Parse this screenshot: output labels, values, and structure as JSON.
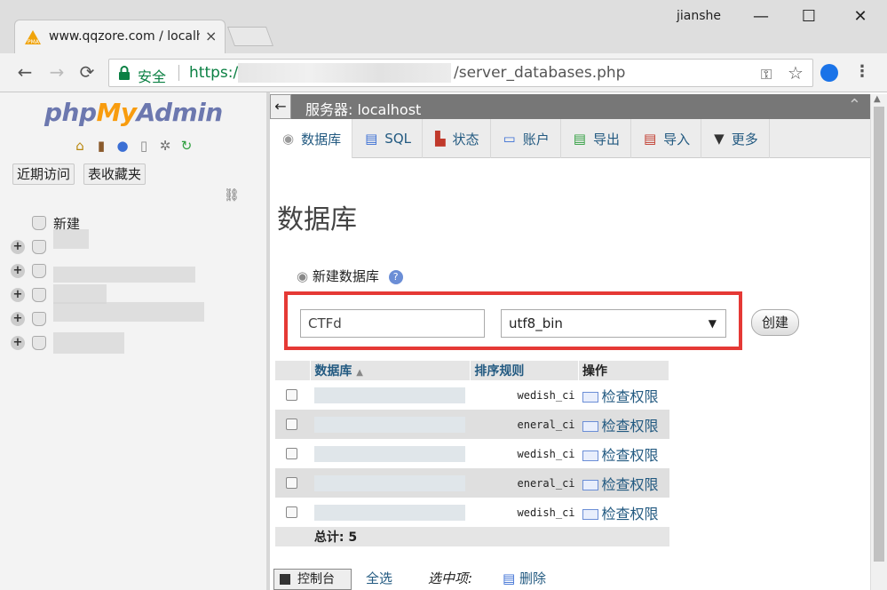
{
  "browser": {
    "tab_title": "www.qqzore.com / localhost",
    "tab_close": "×",
    "window_user": "jianshe",
    "minimize": "—",
    "maximize": "☐",
    "close": "✕",
    "secure_label": "安全",
    "url_scheme": "https://",
    "url_path": "/server_databases.php",
    "back": "←",
    "forward": "→",
    "reload": "⟳"
  },
  "pma": {
    "logo_php": "php",
    "logo_my": "My",
    "logo_admin": "Admin",
    "recent": "近期访问",
    "favorites": "表收藏夹",
    "tree_new": "新建",
    "server_label": "服务器: localhost",
    "tabs": [
      {
        "label": "数据库",
        "icon": "database-icon",
        "active": true
      },
      {
        "label": "SQL",
        "icon": "sql-icon",
        "active": false
      },
      {
        "label": "状态",
        "icon": "status-icon",
        "active": false
      },
      {
        "label": "账户",
        "icon": "accounts-icon",
        "active": false
      },
      {
        "label": "导出",
        "icon": "export-icon",
        "active": false
      },
      {
        "label": "导入",
        "icon": "import-icon",
        "active": false
      },
      {
        "label": "更多",
        "icon": "more-icon",
        "active": false
      }
    ],
    "page_title": "数据库",
    "create_heading": "新建数据库",
    "db_name_value": "CTFd",
    "collation_value": "utf8_bin",
    "create_button": "创建",
    "table": {
      "col_database": "数据库",
      "col_collation": "排序规则",
      "col_action": "操作",
      "rows": [
        {
          "collation": "wedish_ci",
          "action": "检查权限"
        },
        {
          "collation": "eneral_ci",
          "action": "检查权限"
        },
        {
          "collation": "wedish_ci",
          "action": "检查权限"
        },
        {
          "collation": "eneral_ci",
          "action": "检查权限"
        },
        {
          "collation": "wedish_ci",
          "action": "检查权限"
        }
      ],
      "total": "总计: 5"
    },
    "console": "控制台",
    "select_all": "全选",
    "with_selected": "选中项:",
    "delete": "删除"
  }
}
